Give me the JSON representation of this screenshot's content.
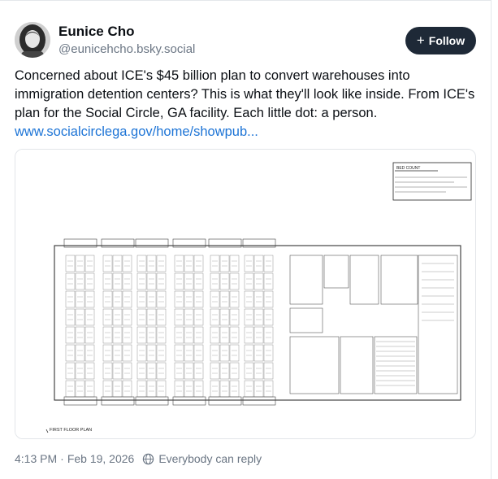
{
  "author": {
    "name": "Eunice Cho",
    "handle": "@eunicehcho.bsky.social"
  },
  "follow_button": {
    "icon": "plus-icon",
    "label": "Follow"
  },
  "post": {
    "text": "Concerned about ICE's $45 billion plan to convert warehouses into immigration detention centers? This is what they'll look like inside. From ICE's plan for the Social Circle, GA facility. Each little dot: a person.",
    "link": "www.socialcirclega.gov/home/showpub..."
  },
  "floor_plan": {
    "title": "FIRST FLOOR PLAN",
    "bed_count_title": "BED COUNT"
  },
  "meta": {
    "time": "4:13 PM",
    "separator": "·",
    "date": "Feb 19, 2026",
    "reply_icon": "globe-icon",
    "reply_setting": "Everybody can reply"
  },
  "colors": {
    "follow_bg": "#1e2937",
    "link": "#1d74d6",
    "muted": "#6b7684"
  }
}
